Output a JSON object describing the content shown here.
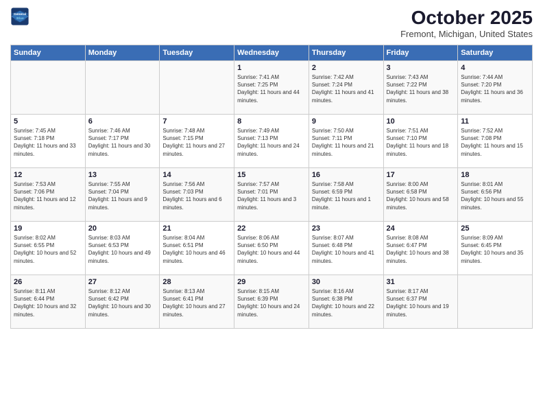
{
  "logo": {
    "line1": "General",
    "line2": "Blue"
  },
  "title": "October 2025",
  "subtitle": "Fremont, Michigan, United States",
  "days": [
    "Sunday",
    "Monday",
    "Tuesday",
    "Wednesday",
    "Thursday",
    "Friday",
    "Saturday"
  ],
  "weeks": [
    [
      {
        "day": "",
        "info": ""
      },
      {
        "day": "",
        "info": ""
      },
      {
        "day": "",
        "info": ""
      },
      {
        "day": "1",
        "info": "Sunrise: 7:41 AM\nSunset: 7:25 PM\nDaylight: 11 hours and 44 minutes."
      },
      {
        "day": "2",
        "info": "Sunrise: 7:42 AM\nSunset: 7:24 PM\nDaylight: 11 hours and 41 minutes."
      },
      {
        "day": "3",
        "info": "Sunrise: 7:43 AM\nSunset: 7:22 PM\nDaylight: 11 hours and 38 minutes."
      },
      {
        "day": "4",
        "info": "Sunrise: 7:44 AM\nSunset: 7:20 PM\nDaylight: 11 hours and 36 minutes."
      }
    ],
    [
      {
        "day": "5",
        "info": "Sunrise: 7:45 AM\nSunset: 7:18 PM\nDaylight: 11 hours and 33 minutes."
      },
      {
        "day": "6",
        "info": "Sunrise: 7:46 AM\nSunset: 7:17 PM\nDaylight: 11 hours and 30 minutes."
      },
      {
        "day": "7",
        "info": "Sunrise: 7:48 AM\nSunset: 7:15 PM\nDaylight: 11 hours and 27 minutes."
      },
      {
        "day": "8",
        "info": "Sunrise: 7:49 AM\nSunset: 7:13 PM\nDaylight: 11 hours and 24 minutes."
      },
      {
        "day": "9",
        "info": "Sunrise: 7:50 AM\nSunset: 7:11 PM\nDaylight: 11 hours and 21 minutes."
      },
      {
        "day": "10",
        "info": "Sunrise: 7:51 AM\nSunset: 7:10 PM\nDaylight: 11 hours and 18 minutes."
      },
      {
        "day": "11",
        "info": "Sunrise: 7:52 AM\nSunset: 7:08 PM\nDaylight: 11 hours and 15 minutes."
      }
    ],
    [
      {
        "day": "12",
        "info": "Sunrise: 7:53 AM\nSunset: 7:06 PM\nDaylight: 11 hours and 12 minutes."
      },
      {
        "day": "13",
        "info": "Sunrise: 7:55 AM\nSunset: 7:04 PM\nDaylight: 11 hours and 9 minutes."
      },
      {
        "day": "14",
        "info": "Sunrise: 7:56 AM\nSunset: 7:03 PM\nDaylight: 11 hours and 6 minutes."
      },
      {
        "day": "15",
        "info": "Sunrise: 7:57 AM\nSunset: 7:01 PM\nDaylight: 11 hours and 3 minutes."
      },
      {
        "day": "16",
        "info": "Sunrise: 7:58 AM\nSunset: 6:59 PM\nDaylight: 11 hours and 1 minute."
      },
      {
        "day": "17",
        "info": "Sunrise: 8:00 AM\nSunset: 6:58 PM\nDaylight: 10 hours and 58 minutes."
      },
      {
        "day": "18",
        "info": "Sunrise: 8:01 AM\nSunset: 6:56 PM\nDaylight: 10 hours and 55 minutes."
      }
    ],
    [
      {
        "day": "19",
        "info": "Sunrise: 8:02 AM\nSunset: 6:55 PM\nDaylight: 10 hours and 52 minutes."
      },
      {
        "day": "20",
        "info": "Sunrise: 8:03 AM\nSunset: 6:53 PM\nDaylight: 10 hours and 49 minutes."
      },
      {
        "day": "21",
        "info": "Sunrise: 8:04 AM\nSunset: 6:51 PM\nDaylight: 10 hours and 46 minutes."
      },
      {
        "day": "22",
        "info": "Sunrise: 8:06 AM\nSunset: 6:50 PM\nDaylight: 10 hours and 44 minutes."
      },
      {
        "day": "23",
        "info": "Sunrise: 8:07 AM\nSunset: 6:48 PM\nDaylight: 10 hours and 41 minutes."
      },
      {
        "day": "24",
        "info": "Sunrise: 8:08 AM\nSunset: 6:47 PM\nDaylight: 10 hours and 38 minutes."
      },
      {
        "day": "25",
        "info": "Sunrise: 8:09 AM\nSunset: 6:45 PM\nDaylight: 10 hours and 35 minutes."
      }
    ],
    [
      {
        "day": "26",
        "info": "Sunrise: 8:11 AM\nSunset: 6:44 PM\nDaylight: 10 hours and 32 minutes."
      },
      {
        "day": "27",
        "info": "Sunrise: 8:12 AM\nSunset: 6:42 PM\nDaylight: 10 hours and 30 minutes."
      },
      {
        "day": "28",
        "info": "Sunrise: 8:13 AM\nSunset: 6:41 PM\nDaylight: 10 hours and 27 minutes."
      },
      {
        "day": "29",
        "info": "Sunrise: 8:15 AM\nSunset: 6:39 PM\nDaylight: 10 hours and 24 minutes."
      },
      {
        "day": "30",
        "info": "Sunrise: 8:16 AM\nSunset: 6:38 PM\nDaylight: 10 hours and 22 minutes."
      },
      {
        "day": "31",
        "info": "Sunrise: 8:17 AM\nSunset: 6:37 PM\nDaylight: 10 hours and 19 minutes."
      },
      {
        "day": "",
        "info": ""
      }
    ]
  ]
}
